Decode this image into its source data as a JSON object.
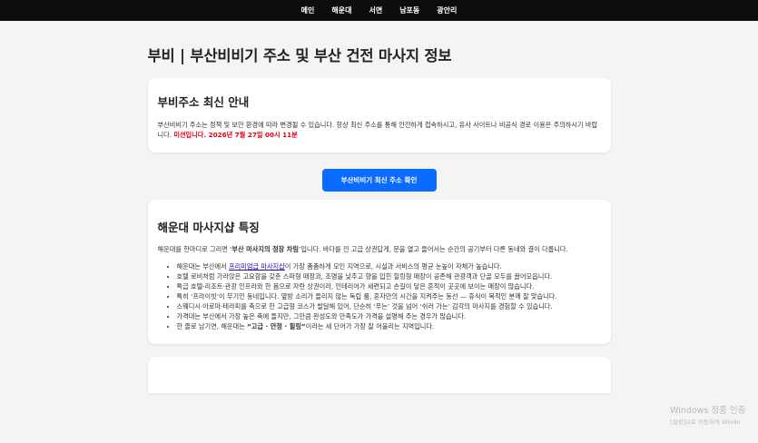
{
  "nav": [
    "메인",
    "해운대",
    "서면",
    "남포동",
    "광안리"
  ],
  "page_title": "부비 | 부산비비기 주소 및 부산 건전 마사지 정보",
  "notice": {
    "title": "부비주소 최신 안내",
    "text": "부산비비기 주소는 정책 및 보안 환경에 따라 변경될 수 있습니다. 항상 최신 주소를 통해 안전하게 접속하시고, 유사 사이트나 비공식 경로 이용은 주의하시기 바랍니다.",
    "highlight": "미션입니다. 2026년 7월 27일 00시 11분"
  },
  "cta_button": "부산비비기 최신 주소 확인",
  "section": {
    "title": "해운대 마사지샵 특징",
    "intro_a": "해운대를 한마디로 그리면 ‘",
    "intro_bold": "부산 마사지의 정장 차림",
    "intro_b": "’입니다. 바다를 낀 고급 상권답게, 문을 열고 들어서는 순간의 공기부터 다른 동네와 결이 다릅니다.",
    "bullet1_a": "해운대는 부산에서 ",
    "bullet1_link": "프리미엄급 마사지샵",
    "bullet1_b": "이 가장 촘촘하게 모인 지역으로, 시설과 서비스의 평균 눈높이 자체가 높습니다.",
    "bullets": [
      "호텔 로비처럼 가라앉은 고요함을 갖춘 스파형 매장과, 조명을 낮추고 향을 입힌 힐링형 매장이 공존해 관광객과 단골 모두를 끌어모읍니다.",
      "특급 호텔·리조트·관광 인프라와 한 몸으로 자란 상권이라, 인테리어가 세련되고 손길이 닿은 흔적이 곳곳에 보이는 매장이 많습니다.",
      "특히 ‘프라이빗’이 무기인 동네입니다. 옆방 소리가 들리지 않는 독립 룸, 혼자만의 시간을 지켜주는 동선 — 휴식이 목적인 분께 잘 맞습니다.",
      "스웨디시·아로마·테라피를 축으로 한 고급형 코스가 발달해 있어, 단순히 ‘푸는’ 것을 넘어 ‘쉬러 가는’ 감각의 마사지를 경험할 수 있습니다.",
      "가격대는 부산에서 가장 높은 축에 들지만, 그만큼 완성도와 만족도가 가격을 설명해 주는 경우가 많습니다."
    ],
    "last_a": "한 줄로 남기면, 해운대는 ",
    "last_bold": "“고급 · 안정 · 힐링”",
    "last_b": "이라는 세 단어가 가장 잘 어울리는 지역입니다."
  },
  "watermark": {
    "line1": "Windows 정품 인증",
    "line2": "[설정]으로 이동하여 Windo"
  },
  "colors": {
    "nav_bg": "#0d0d0d",
    "accent": "#0a6cff",
    "highlight": "#e60012",
    "page_bg": "#f4f4f4"
  }
}
